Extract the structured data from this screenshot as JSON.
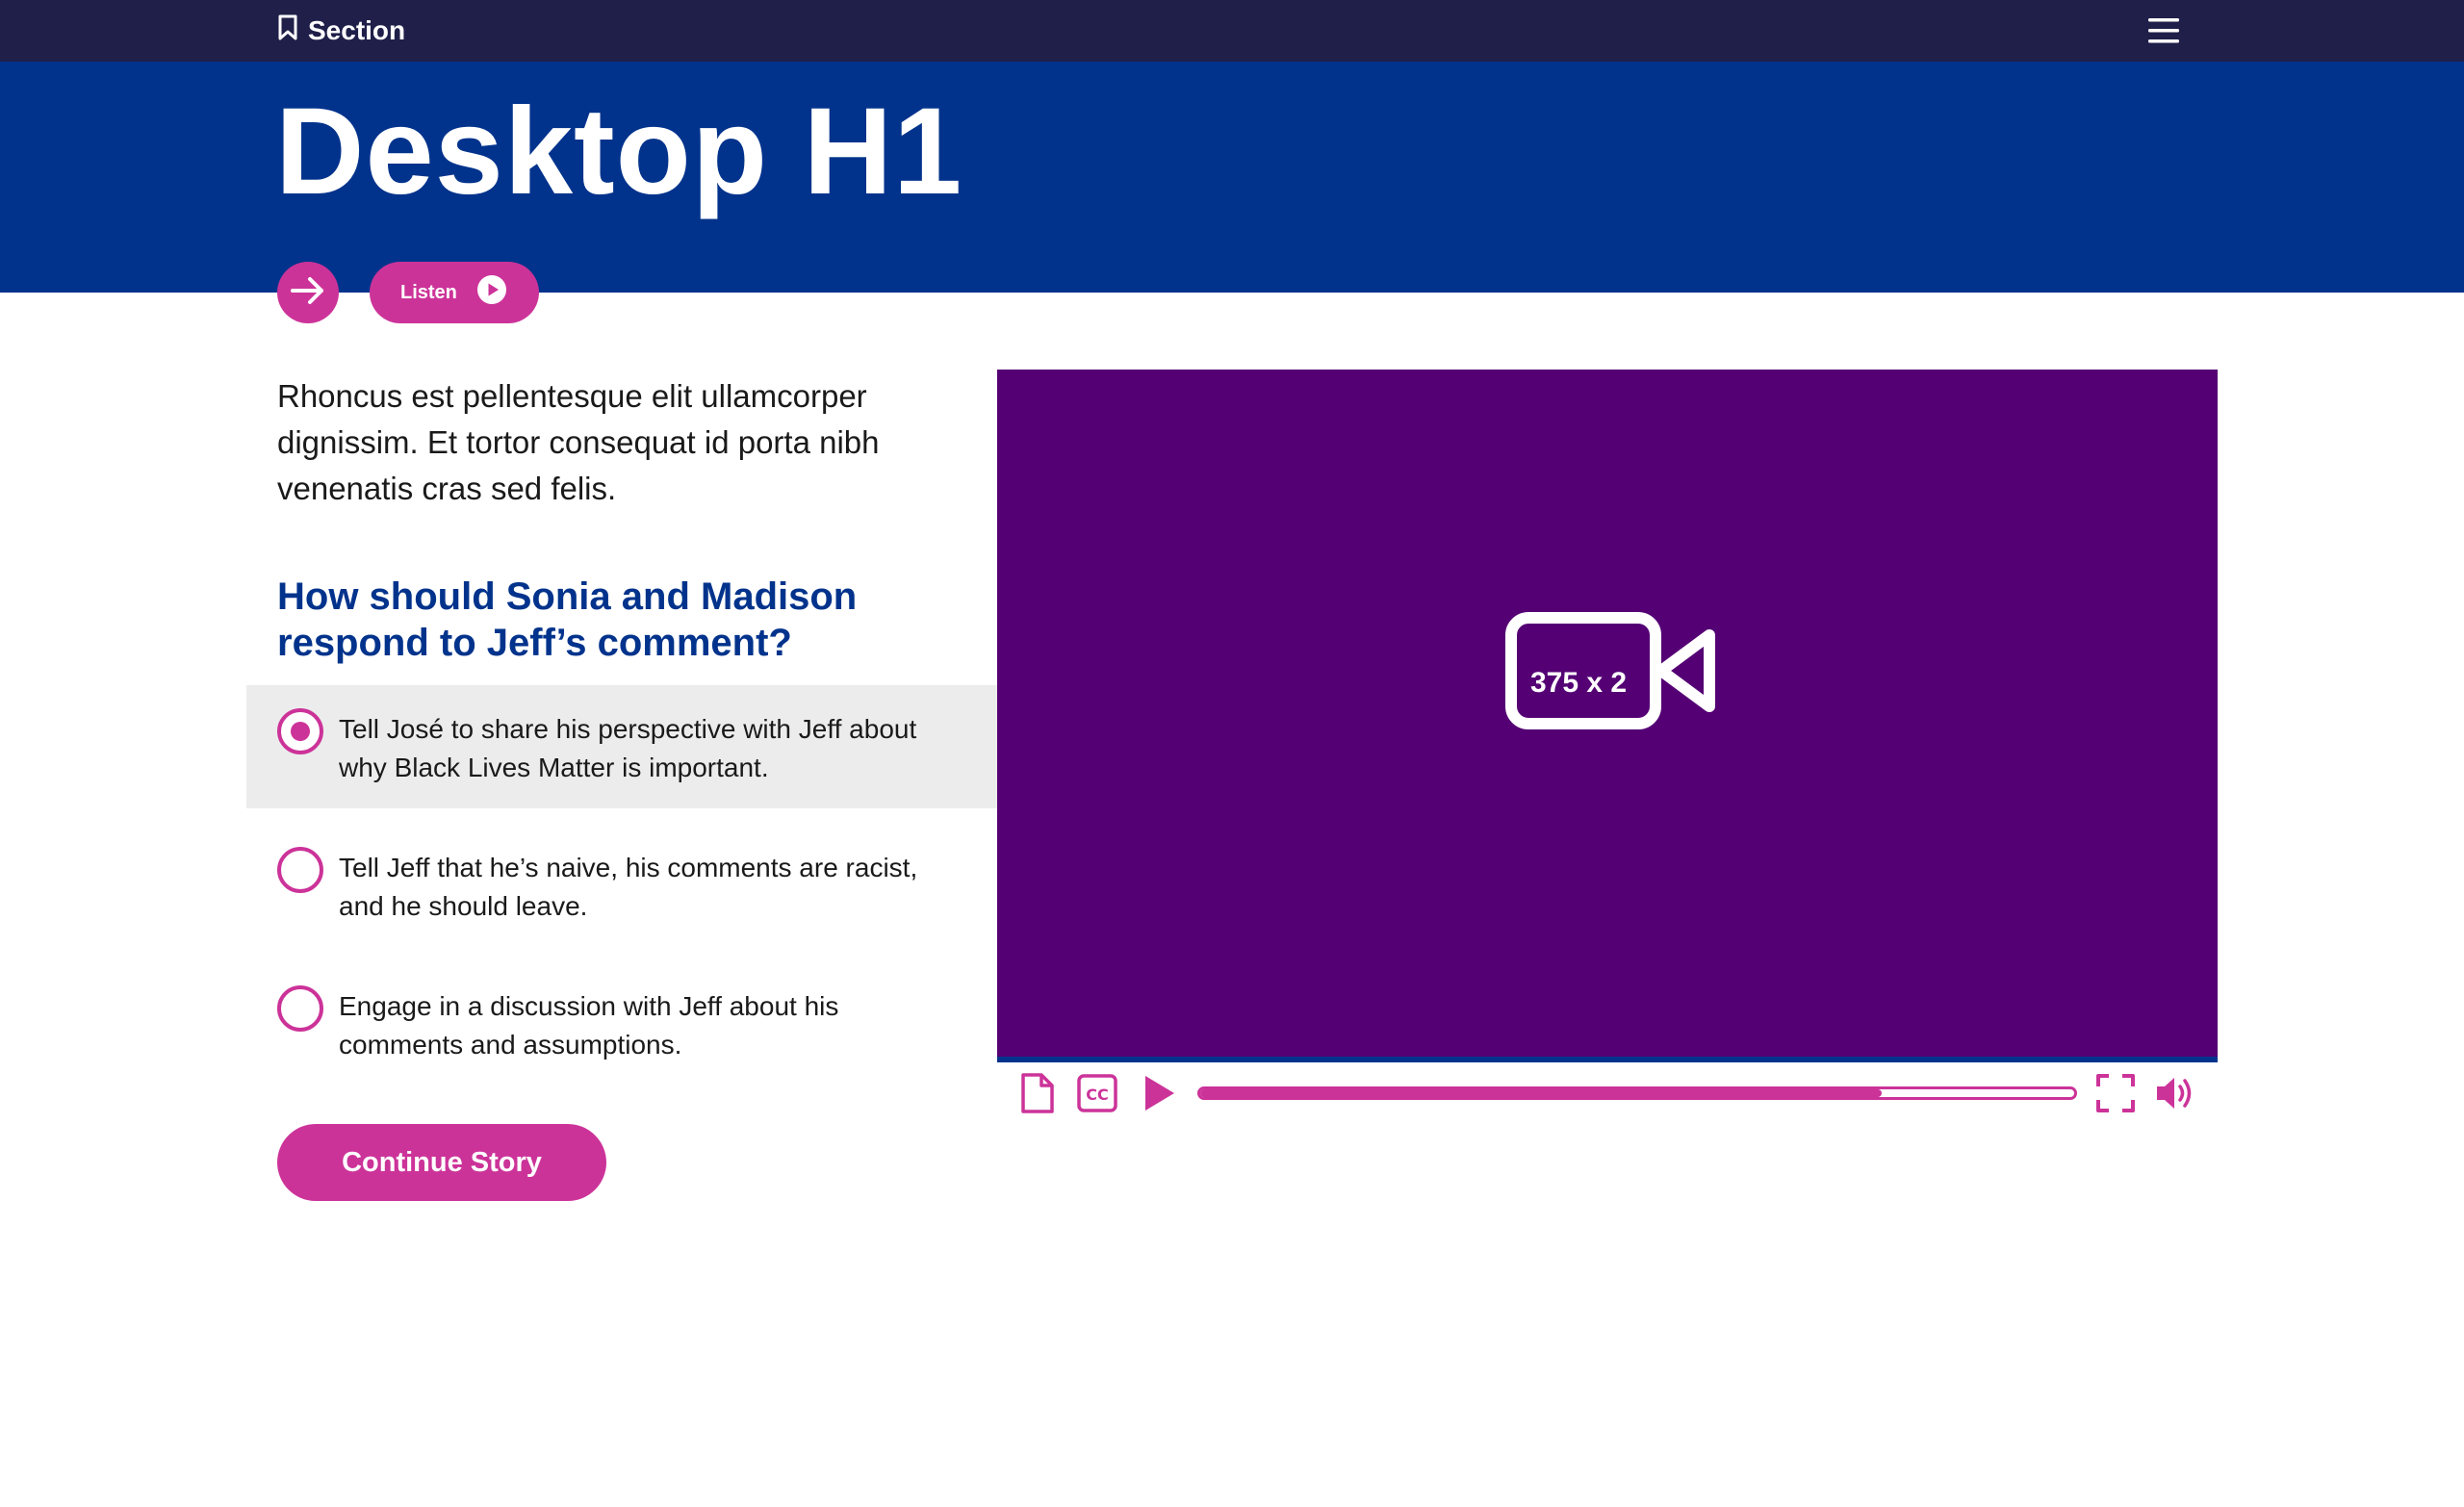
{
  "topbar": {
    "section_label": "Section",
    "section_icon": "bookmark-icon",
    "menu_icon": "hamburger-menu-icon"
  },
  "hero": {
    "title": "Desktop H1"
  },
  "actions": {
    "arrow_icon": "arrow-right-icon",
    "listen_label": "Listen",
    "listen_icon": "play-circle-icon"
  },
  "intro": "Rhoncus est pellentesque elit ullamcorper dignissim. Et tortor consequat id porta nibh venenatis cras sed felis.",
  "question": "How should Sonia and Madison respond to Jeff’s comment?",
  "options": [
    {
      "label": "Tell José to share his perspective with Jeff about why Black Lives Matter is important.",
      "selected": true
    },
    {
      "label": "Tell Jeff that he’s naive, his comments are racist, and he should leave.",
      "selected": false
    },
    {
      "label": "Engage in a discussion with Jeff about his comments and assumptions.",
      "selected": false
    }
  ],
  "continue_label": "Continue Story",
  "video": {
    "placeholder_text": "375 x 2",
    "placeholder_icon": "video-camera-icon",
    "progress": 0.78,
    "controls": [
      "transcript-icon",
      "closed-captions-icon",
      "play-icon",
      "fullscreen-icon",
      "volume-icon"
    ],
    "cc_label": "CC"
  },
  "colors": {
    "topbar": "#1f1f4a",
    "hero": "#02338c",
    "accent": "#cc3399",
    "video_bg": "#540074",
    "question": "#02338c",
    "selected_option_bg": "#ececec"
  }
}
